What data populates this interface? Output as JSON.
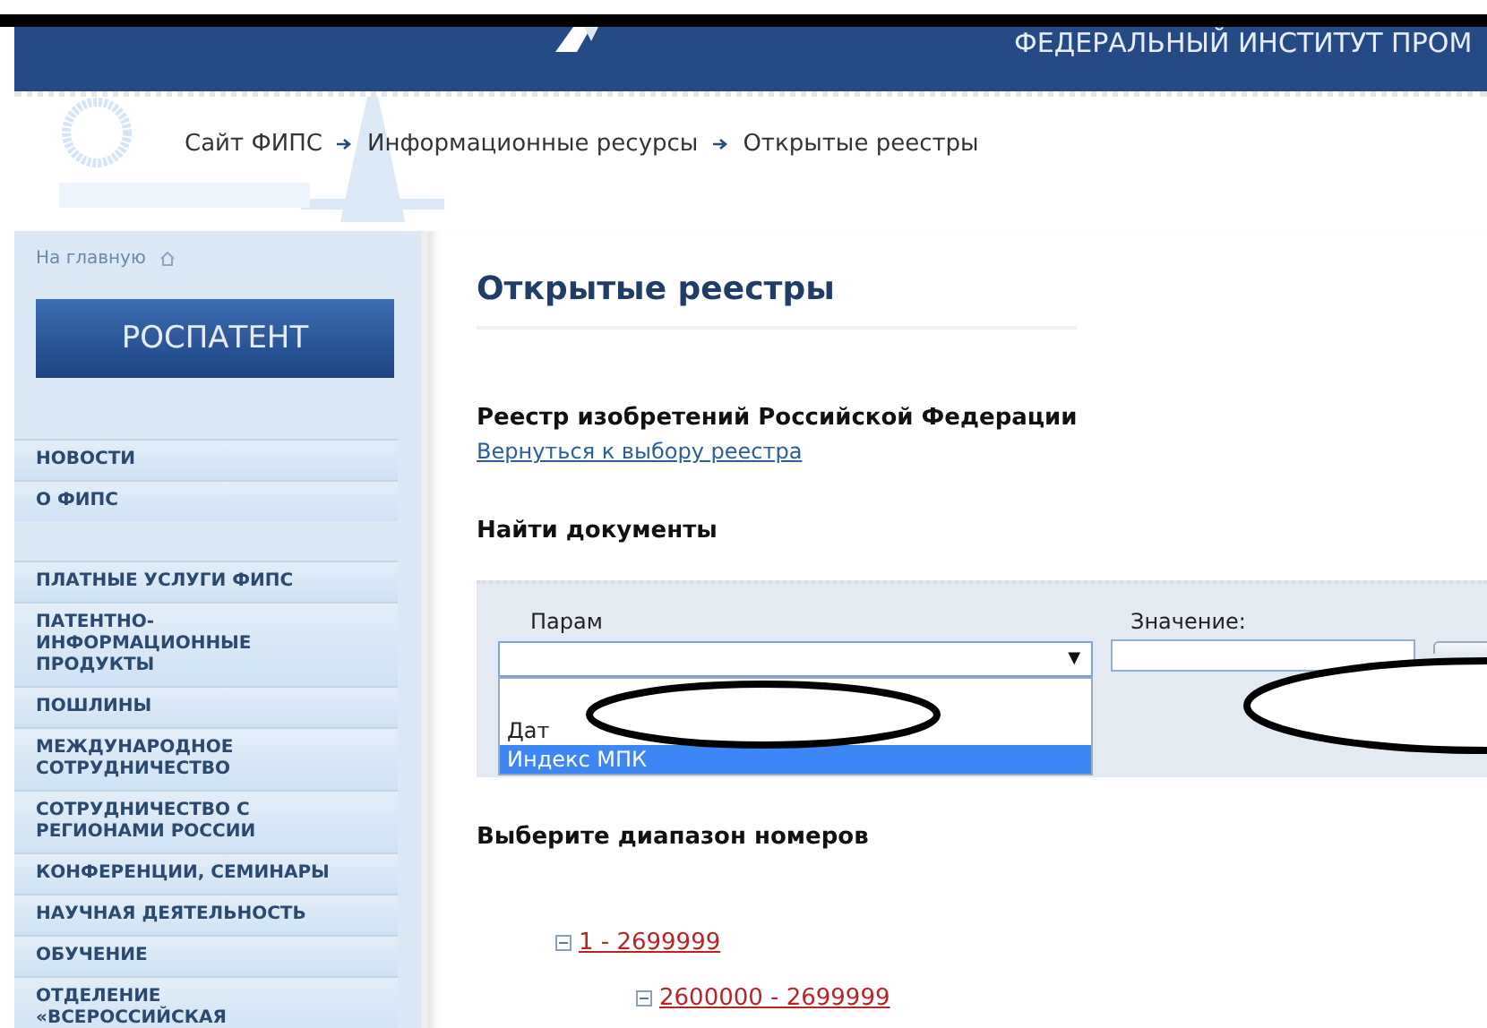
{
  "header": {
    "subtitle": "ФЕДЕРАЛЬНЫЙ ИНСТИТУТ ПРОМ"
  },
  "breadcrumbs": [
    "Сайт ФИПС",
    "Информационные ресурсы",
    "Открытые реестры"
  ],
  "sidebar": {
    "home": "На главную",
    "banner": "РОСПАТЕНТ",
    "menu_groups": [
      [
        "НОВОСТИ",
        "О ФИПС"
      ],
      [
        "ПЛАТНЫЕ УСЛУГИ ФИПС",
        "ПАТЕНТНО-ИНФОРМАЦИОННЫЕ ПРОДУКТЫ",
        "ПОШЛИНЫ",
        "МЕЖДУНАРОДНОЕ СОТРУДНИЧЕСТВО",
        "СОТРУДНИЧЕСТВО С РЕГИОНАМИ РОССИИ",
        "КОНФЕРЕНЦИИ, СЕМИНАРЫ",
        "НАУЧНАЯ ДЕЯТЕЛЬНОСТЬ",
        "ОБУЧЕНИЕ",
        "ОТДЕЛЕНИЕ «ВСЕРОССИЙСКАЯ"
      ]
    ]
  },
  "page_title": "Открытые реестры",
  "registry_title": "Реестр изобретений Российской Федерации",
  "back_link": "Вернуться к выбору реестра",
  "find_heading": "Найти документы",
  "search": {
    "param_label": "Парам",
    "value_label": "Значение:",
    "dropdown_arrow": "▼",
    "options": [
      {
        "label": "Дат",
        "selected": false
      },
      {
        "label": "Индекс МПК",
        "selected": true
      }
    ]
  },
  "range_heading": "Выберите диапазон номеров",
  "tree": [
    {
      "label": "1 - 2699999",
      "expanded": true,
      "children": [
        {
          "label": "2600000 - 2699999",
          "expanded": true
        }
      ]
    }
  ]
}
